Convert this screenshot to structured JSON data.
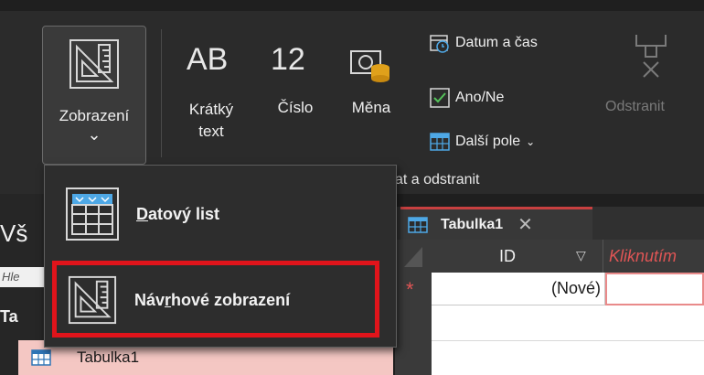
{
  "ribbon": {
    "view_label": "Zobrazení",
    "view_chevron": "⌄",
    "short_text_icon": "AB",
    "short_text_label": "Krátký\ntext",
    "number_icon": "12",
    "number_label": "Číslo",
    "currency_label": "Měna",
    "date_time_label": "Datum a čas",
    "yes_no_label": "Ano/Ne",
    "more_fields_label": "Další pole",
    "delete_label": "Odstranit",
    "group_label": "at a odstranit"
  },
  "menu": {
    "datasheet_label_u": "D",
    "datasheet_label_rest": "atový list",
    "design_label_a": "Náv",
    "design_label_u": "r",
    "design_label_b": "hové zobrazení"
  },
  "nav": {
    "title_partial": "Vš",
    "search_placeholder": "Hle",
    "section_partial": "Ta",
    "item_label": "Tabulka1"
  },
  "table": {
    "tab_label": "Tabulka1",
    "col_id": "ID",
    "col_next": "Kliknutím",
    "new_row_marker": "*",
    "new_row_id": "(Nové)"
  },
  "colors": {
    "highlight": "#e0141b",
    "tab_accent": "#c84040",
    "nav_selected": "#f4c7c3"
  }
}
